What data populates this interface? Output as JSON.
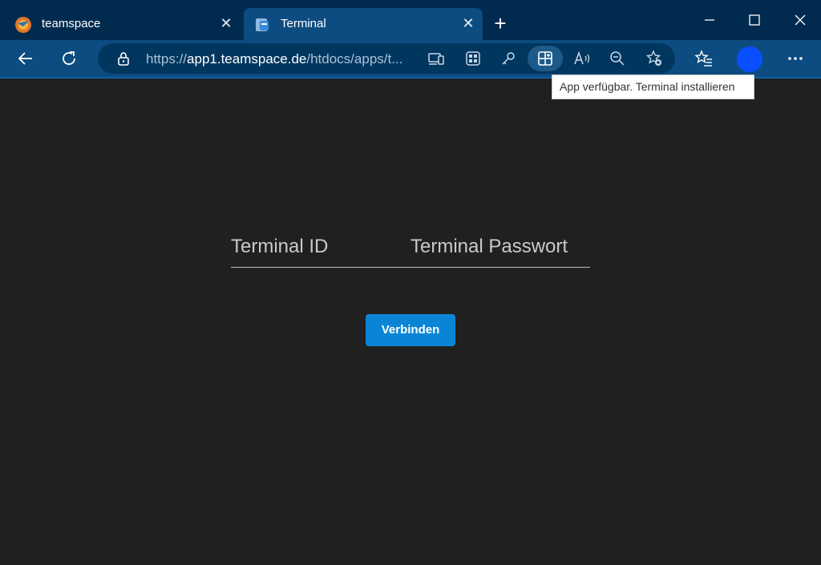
{
  "tabs": [
    {
      "label": "teamspace",
      "active": false,
      "icon": "teamspace-logo-icon"
    },
    {
      "label": "Terminal",
      "active": true,
      "icon": "terminal-page-icon"
    }
  ],
  "toolbar": {
    "url_prefix": "https://",
    "url_host": "app1.teamspace.de",
    "url_path": "/htdocs/apps/t...",
    "install_app_tooltip": "App verfügbar. Terminal installieren"
  },
  "login": {
    "terminal_id_placeholder": "Terminal ID",
    "terminal_password_placeholder": "Terminal Passwort",
    "connect_label": "Verbinden"
  },
  "colors": {
    "page_background": "#202020",
    "accent_button": "#0a85d6",
    "browser_frame": "#0c4c80",
    "avatar": "#0a4fff"
  }
}
